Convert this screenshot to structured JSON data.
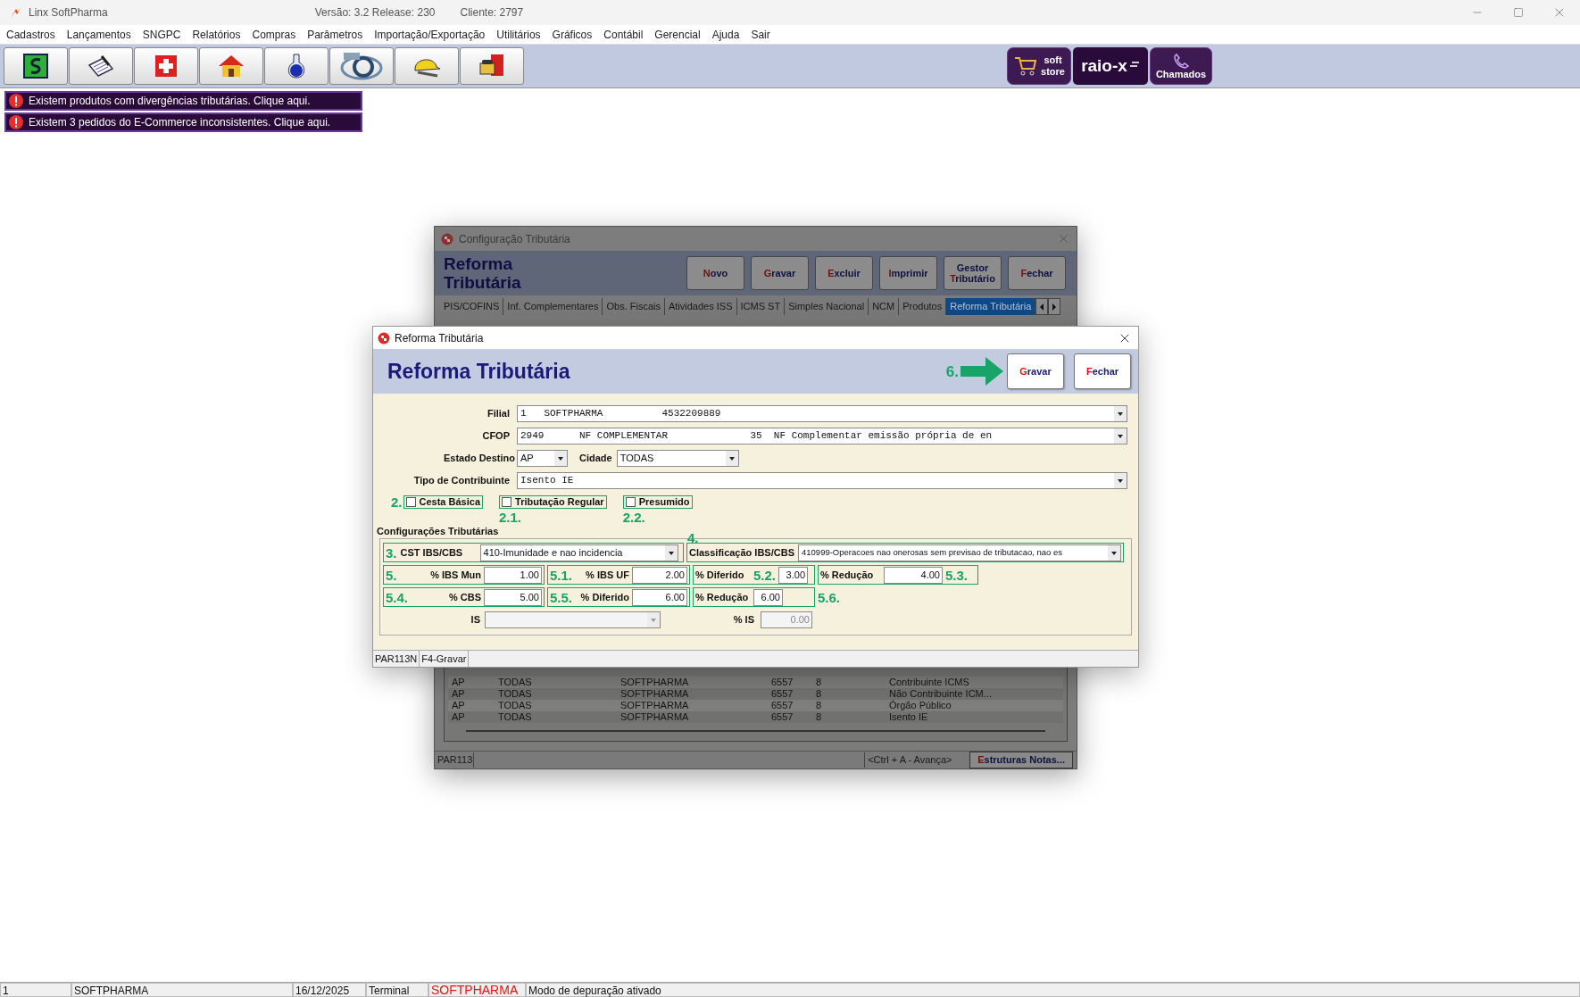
{
  "app": {
    "title": "Linx SoftPharma",
    "version": "Versão: 3.2 Release: 230",
    "client": "Cliente: 2797"
  },
  "menu": [
    "Cadastros",
    "Lançamentos",
    "SNGPC",
    "Relatórios",
    "Compras",
    "Parâmetros",
    "Importação/Exportação",
    "Utilitários",
    "Gráficos",
    "Contábil",
    "Gerencial",
    "Ajuda",
    "Sair"
  ],
  "promo_buttons": [
    {
      "kind": "store",
      "lines": [
        "soft",
        "store"
      ]
    },
    {
      "kind": "logo",
      "label": "raio-x"
    },
    {
      "kind": "calls",
      "label": "Chamados"
    }
  ],
  "alerts": [
    "Existem produtos com divergências tributárias. Clique aqui.",
    "Existem 3 pedidos do E-Commerce inconsistentes. Clique aqui."
  ],
  "background_window": {
    "title": "Configuração Tributária",
    "heading_lines": [
      "Reforma",
      "Tributária"
    ],
    "buttons": [
      {
        "key": "N",
        "rest": "ovo"
      },
      {
        "key": "G",
        "rest": "ravar"
      },
      {
        "key": "E",
        "rest": "xcluir"
      },
      {
        "key": "I",
        "rest": "mprimir"
      },
      {
        "pre": "Gestor ",
        "key": "T",
        "rest": "ributário"
      },
      {
        "key": "F",
        "rest": "echar"
      }
    ],
    "tabs": [
      {
        "label": "PIS/COFINS",
        "selected": false
      },
      {
        "label": "Inf. Complementares",
        "selected": false
      },
      {
        "label": "Obs. Fiscais",
        "selected": false
      },
      {
        "label": "Atividades ISS",
        "selected": false
      },
      {
        "label": "ICMS ST",
        "selected": false
      },
      {
        "label": "Simples Nacional",
        "selected": false
      },
      {
        "label": "NCM",
        "selected": false
      },
      {
        "label": "Produtos",
        "selected": false
      },
      {
        "label": "Reforma Tributária",
        "selected": true
      }
    ],
    "rows": [
      [
        "AP",
        "TODAS",
        "SOFTPHARMA",
        "6557",
        "8",
        "Contribuinte ICMS"
      ],
      [
        "AP",
        "TODAS",
        "SOFTPHARMA",
        "6557",
        "8",
        "Não Contribuinte ICM..."
      ],
      [
        "AP",
        "TODAS",
        "SOFTPHARMA",
        "6557",
        "8",
        "Órgão Público"
      ],
      [
        "AP",
        "TODAS",
        "SOFTPHARMA",
        "6557",
        "8",
        "Isento IE"
      ]
    ],
    "status": {
      "code": "PAR113",
      "hint": "<Ctrl + A - Avança>",
      "button": {
        "key": "E",
        "rest": "struturas Notas..."
      }
    }
  },
  "dialog": {
    "title": "Reforma Tributária",
    "heading": "Reforma Tributária",
    "annotation": "6.",
    "buttons": [
      {
        "key": "G",
        "rest": "ravar"
      },
      {
        "key": "F",
        "rest": "echar"
      }
    ],
    "filial": {
      "label": "Filial",
      "value": "1   SOFTPHARMA          4532209889"
    },
    "cfop": {
      "label": "CFOP",
      "value": "2949      NF COMPLEMENTAR              35  NF Complementar emissão própria de en"
    },
    "estado": {
      "label": "Estado Destino",
      "value": "AP"
    },
    "cidade": {
      "label": "Cidade",
      "value": "TODAS"
    },
    "tipo": {
      "label": "Tipo de Contribuinte",
      "value": "Isento IE"
    },
    "checkboxes": [
      {
        "label": "Cesta Básica",
        "checked": false,
        "tag": "2.",
        "kind": "lead"
      },
      {
        "label": "Tributação Regular",
        "checked": false,
        "tag": "2.1.",
        "kind": "below"
      },
      {
        "label": "Presumido",
        "checked": false,
        "tag": "2.2.",
        "kind": "below"
      }
    ],
    "group_title": "Configurações Tributárias",
    "cst": {
      "tag": "3.",
      "label": "CST IBS/CBS",
      "value": "410-Imunidade e nao incidencia"
    },
    "classificacao": {
      "tag": "4.",
      "label": "Classificação IBS/CBS",
      "value": "410999-Operacoes nao onerosas sem previsao de tributacao, nao es"
    },
    "config_rows": [
      [
        {
          "tag": "5.",
          "kind": "lead",
          "label": "% IBS Mun",
          "value": "1.00",
          "framed": true
        },
        {
          "tag": "5.1.",
          "kind": "lead",
          "label": "% IBS UF",
          "value": "2.00",
          "framed": true
        },
        {
          "tag": "5.2.",
          "kind": "middle",
          "label": "% Diferido",
          "value": "3.00",
          "framed": true
        },
        {
          "tag": "5.3.",
          "kind": "end",
          "label": "% Redução",
          "value": "4.00",
          "framed": true
        }
      ],
      [
        {
          "tag": "5.4.",
          "kind": "lead",
          "label": "% CBS",
          "value": "5.00",
          "framed": true
        },
        {
          "tag": "5.5.",
          "kind": "lead",
          "label": "% Diferido",
          "value": "6.00",
          "framed": true
        },
        {
          "tag": "5.6.",
          "kind": "outside",
          "label": "% Redução",
          "value": "6.00",
          "framed": true
        }
      ]
    ],
    "is_row": {
      "label": "IS",
      "percent_label": "% IS",
      "percent_value": "0.00",
      "disabled": true
    },
    "status": [
      "PAR113N",
      "F4-Gravar"
    ]
  },
  "status_bar": [
    {
      "text": "1",
      "kind": "plain"
    },
    {
      "text": "SOFTPHARMA",
      "kind": "plain"
    },
    {
      "text": "16/12/2025",
      "kind": "plain"
    },
    {
      "text": "Terminal",
      "kind": "plain"
    },
    {
      "text": "SOFTPHARMA",
      "kind": "alert"
    },
    {
      "text": "Modo de depuração ativado",
      "kind": "plain"
    }
  ]
}
